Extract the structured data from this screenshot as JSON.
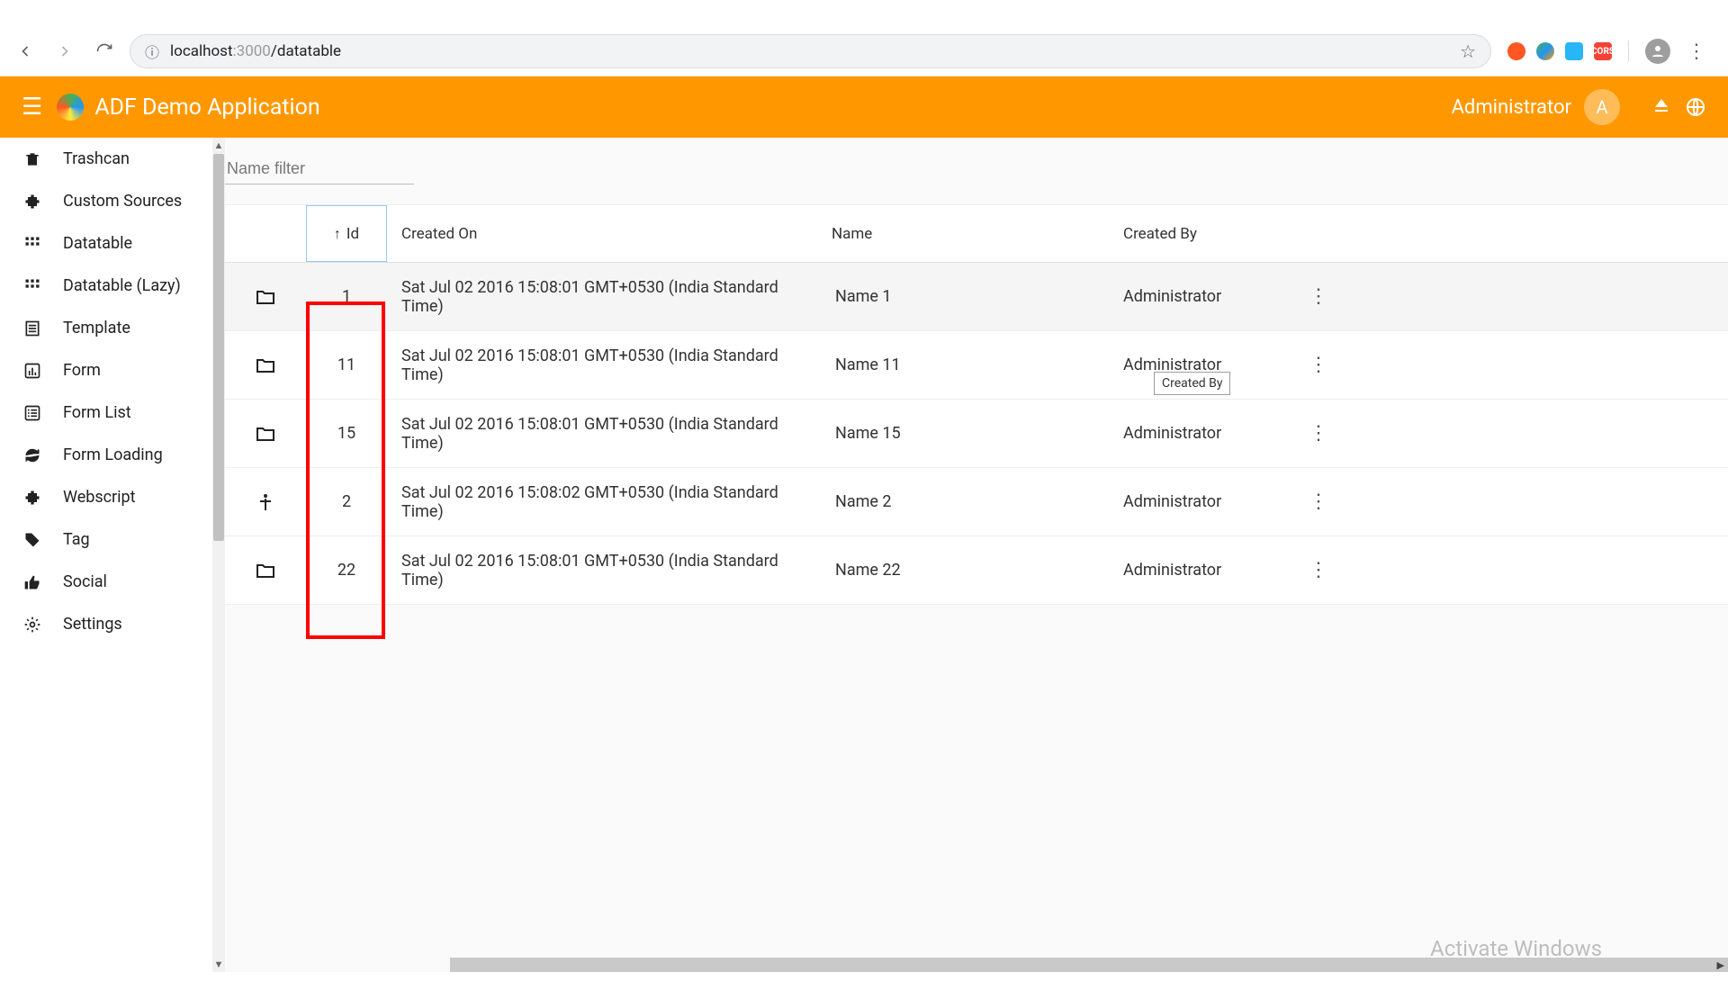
{
  "browser": {
    "url_host": "localhost",
    "url_port": ":3000",
    "url_path": "/datatable"
  },
  "header": {
    "app_title": "ADF Demo Application",
    "user_label": "Administrator",
    "user_initial": "A"
  },
  "sidebar": {
    "items": [
      {
        "icon": "trash",
        "label": "Trashcan"
      },
      {
        "icon": "extension",
        "label": "Custom Sources"
      },
      {
        "icon": "grid",
        "label": "Datatable"
      },
      {
        "icon": "grid",
        "label": "Datatable (Lazy)"
      },
      {
        "icon": "template",
        "label": "Template"
      },
      {
        "icon": "chart",
        "label": "Form"
      },
      {
        "icon": "list",
        "label": "Form List"
      },
      {
        "icon": "sync",
        "label": "Form Loading"
      },
      {
        "icon": "extension",
        "label": "Webscript"
      },
      {
        "icon": "tag",
        "label": "Tag"
      },
      {
        "icon": "thumb",
        "label": "Social"
      },
      {
        "icon": "gear",
        "label": "Settings"
      }
    ]
  },
  "filter": {
    "placeholder": "Name filter"
  },
  "table": {
    "columns": {
      "id": "Id",
      "created_on": "Created On",
      "name": "Name",
      "created_by": "Created By"
    },
    "sort": {
      "column": "id",
      "direction": "asc"
    },
    "rows": [
      {
        "icon": "folder",
        "id": "1",
        "created_on": "Sat Jul 02 2016 15:08:01 GMT+0530 (India Standard Time)",
        "name": "Name 1",
        "created_by": "Administrator"
      },
      {
        "icon": "folder",
        "id": "11",
        "created_on": "Sat Jul 02 2016 15:08:01 GMT+0530 (India Standard Time)",
        "name": "Name 11",
        "created_by": "Administrator"
      },
      {
        "icon": "folder",
        "id": "15",
        "created_on": "Sat Jul 02 2016 15:08:01 GMT+0530 (India Standard Time)",
        "name": "Name 15",
        "created_by": "Administrator"
      },
      {
        "icon": "person",
        "id": "2",
        "created_on": "Sat Jul 02 2016 15:08:02 GMT+0530 (India Standard Time)",
        "name": "Name 2",
        "created_by": "Administrator"
      },
      {
        "icon": "folder",
        "id": "22",
        "created_on": "Sat Jul 02 2016 15:08:01 GMT+0530 (India Standard Time)",
        "name": "Name 22",
        "created_by": "Administrator"
      }
    ]
  },
  "tooltip": {
    "text": "Created By"
  },
  "watermark": {
    "text": "Activate Windows"
  },
  "colors": {
    "accent": "#ff9800",
    "highlight": "#ff0000"
  },
  "ext_cors_label": "CORS"
}
